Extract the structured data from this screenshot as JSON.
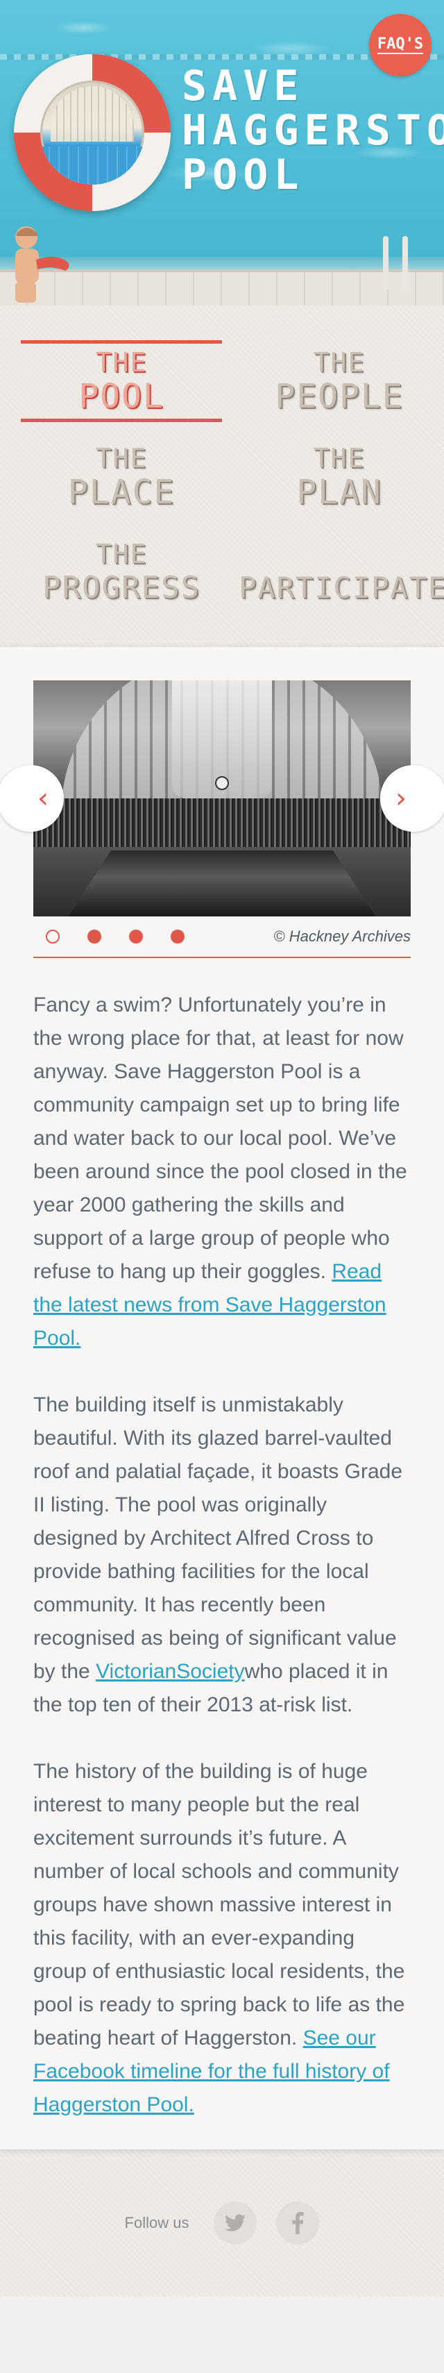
{
  "header": {
    "title_line1": "SAVE",
    "title_line2": "HAGGERSTON",
    "title_line3": "POOL",
    "faq_label": "FAQ'S"
  },
  "nav": {
    "items": [
      {
        "small": "THE",
        "big": "POOL",
        "active": true
      },
      {
        "small": "THE",
        "big": "PEOPLE",
        "active": false
      },
      {
        "small": "THE",
        "big": "PLACE",
        "active": false
      },
      {
        "small": "THE",
        "big": "PLAN",
        "active": false
      },
      {
        "small": "THE",
        "big": "PROGRESS",
        "active": false
      },
      {
        "small": "",
        "big": "PARTICIPATE",
        "active": false
      }
    ]
  },
  "slider": {
    "credit": "© Hackney Archives",
    "dot_count": 4,
    "active_dot": 0,
    "prev_icon": "chevron-left-icon",
    "next_icon": "chevron-right-icon"
  },
  "content": {
    "p1_text": "Fancy a swim? Unfortunately you’re in the wrong place for that, at least for now anyway. Save Haggerston Pool is a community campaign set up to bring life and water back to our local pool. We’ve been around since the pool closed in the year 2000 gathering the skills and support of a large group of people who refuse to hang up their goggles. ",
    "p1_link": "Read the latest news from Save Haggerston Pool.",
    "p2_text_a": "The building itself is unmistakably beautiful. With its glazed barrel-vaulted roof and palatial façade, it boasts Grade II listing. The pool was originally designed by Architect Alfred Cross to provide bathing facilities for the local community. It has recently been recognised as being of significant value by the ",
    "p2_link": "VictorianSociety",
    "p2_text_b": "who placed it in the top ten of their 2013 at-risk list.",
    "p3_text": "The history of the building is of huge interest to many people but the real excitement surrounds it’s future. A number of local schools and community groups have shown massive interest in this facility, with an ever-expanding group of enthusiastic local residents, the pool is ready to spring back to life as the beating heart of Haggerston. ",
    "p3_link": "See our Facebook timeline for the full history of Haggerston Pool."
  },
  "footer": {
    "follow_label": "Follow us",
    "social": [
      "twitter-icon",
      "facebook-icon"
    ]
  },
  "colors": {
    "accent": "#e2574c",
    "link": "#2aa3c4",
    "water": "#4fbdd6",
    "body_text": "#5c6873"
  }
}
